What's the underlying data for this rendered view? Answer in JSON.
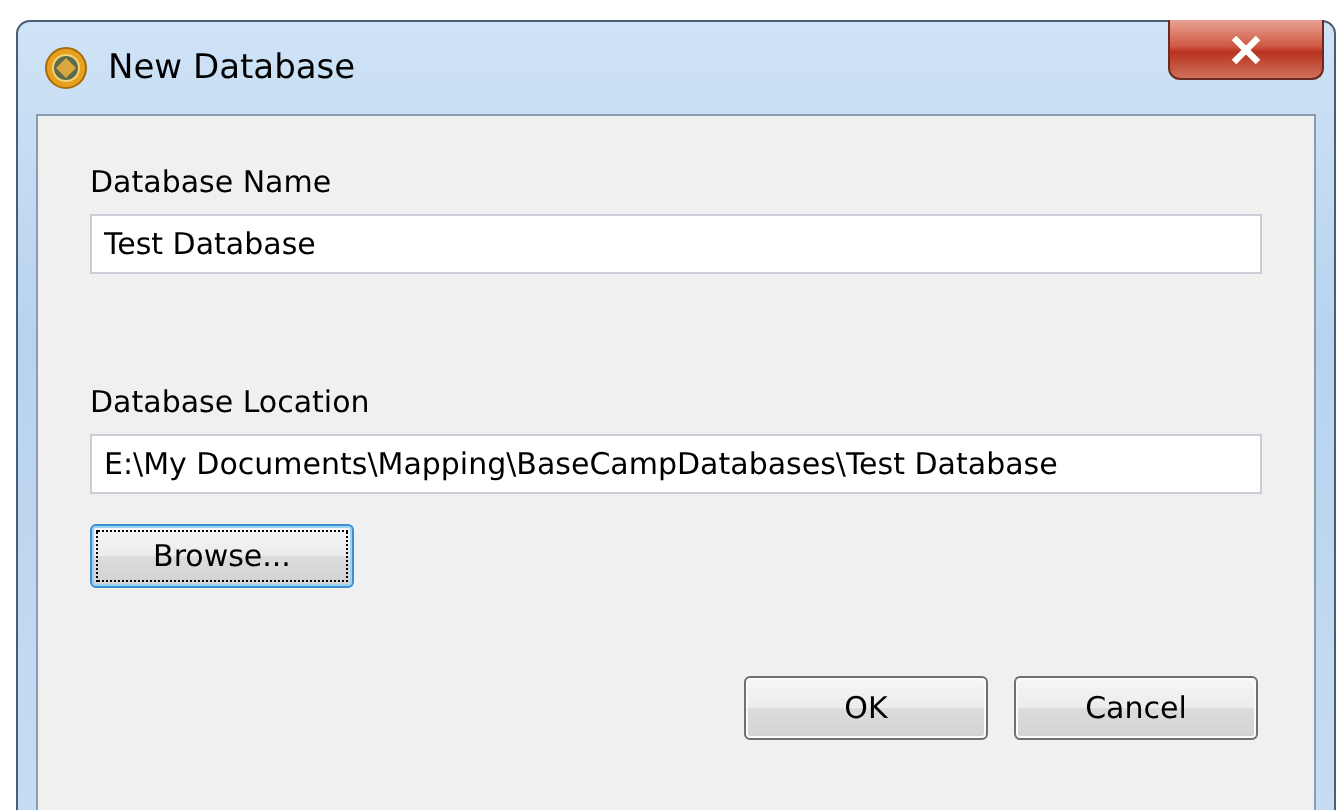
{
  "window": {
    "title": "New Database"
  },
  "fields": [
    {
      "label": "Database Name",
      "value": "Test Database"
    },
    {
      "label": "Database Location",
      "value": "E:\\My Documents\\Mapping\\BaseCampDatabases\\Test Database"
    }
  ],
  "browse_button": {
    "label": "Browse...",
    "focused": true
  },
  "buttons": [
    {
      "label": "OK",
      "focused": false
    },
    {
      "label": "Cancel",
      "focused": false
    }
  ]
}
